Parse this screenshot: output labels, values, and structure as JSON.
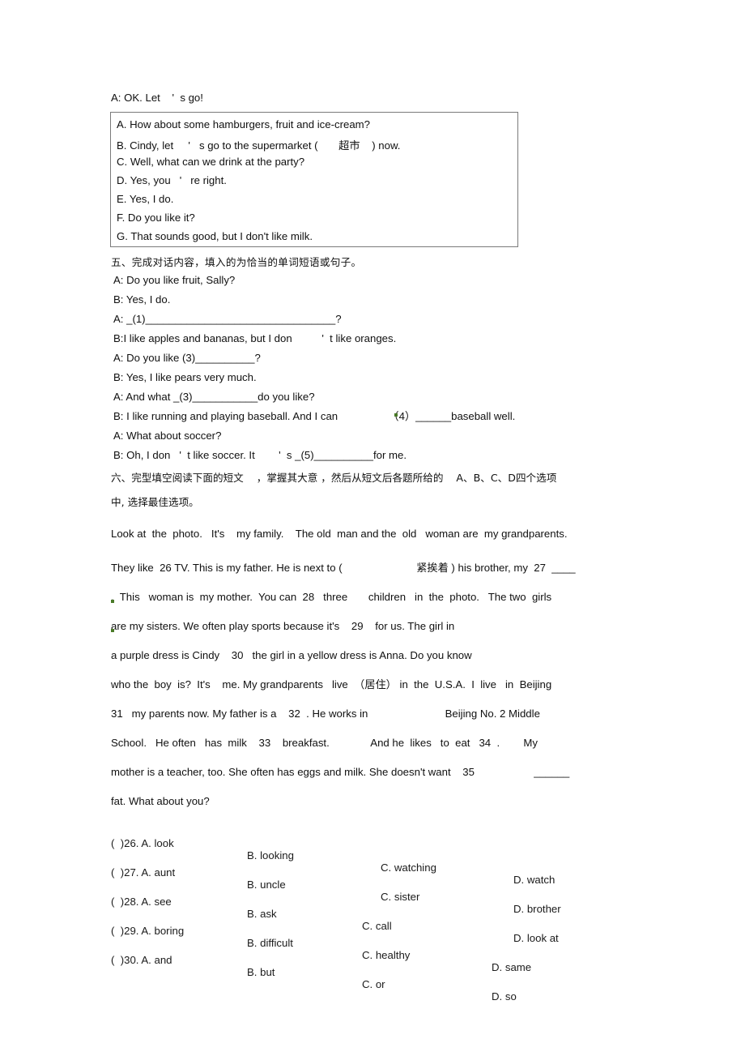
{
  "intro": {
    "line": "A: OK. Let    '  s go!"
  },
  "options_box": {
    "items": [
      "A. How about some hamburgers, fruit and ice-cream?",
      "B. Cindy, let     '   s go to the supermarket (       超市    ) now.",
      "C. Well, what can we drink at the party?",
      "D. Yes, you   '   re right.",
      "E. Yes, I do.",
      "F. Do you like it?",
      "G. That sounds good, but I don't like milk."
    ]
  },
  "section_five": {
    "heading": "五、完成对话内容，填入的为恰当的单词短语或句子。",
    "dialogue": [
      "A: Do you like fruit, Sally?",
      "B: Yes, I do.",
      "A: _(1)________________________________?",
      "B:I like apples and bananas, but I don          '  t like oranges.",
      "A: Do you like (3)__________?",
      "B: Yes, I like pears very much.",
      "A: And what _(3)___________do you like?",
      "B: I like running and playing baseball. And I can                 （4）______baseball well.",
      "A: What about soccer?",
      "B: Oh, I don   '  t like soccer. It        '  s _(5)__________for me."
    ]
  },
  "section_six": {
    "heading_line_1": "六、完型填空阅读下面的短文    ，掌握其大意 ，然后从短文后各题所给的    A、B、C、D四个选项",
    "heading_line_2": "中, 选择最佳选项。",
    "passage": [
      "Look at  the  photo.   It's    my family.    The old  man and the  old   woman are  my grandparents.",
      "They like  26 TV. This is my father. He is next to (                         紧挨着 ) his brother, my  27  ____",
      ".  This   woman is  my mother.  You can  28   three       children   in  the  photo.   The two  girls",
      "are my sisters. We often play sports because it's    29    for us. The girl in ",
      "a purple dress is Cindy    30   the girl in a yellow dress is Anna. Do you know",
      "who the  boy  is?  It's    me. My grandparents   live  （居住） in  the  U.S.A.  I  live   in  Beijing",
      "31   my parents now. My father is a    32  . He works in                          Beijing No. 2 Middle",
      "School.   He often   has  milk    33    breakfast.              And he  likes   to  eat   34  .        My",
      "mother is a teacher, too. She often has eggs and milk. She doesn't want    35                    ______",
      "fat. What about you?"
    ]
  },
  "mcq": {
    "rows": [
      {
        "stem": "(  )26. A. look",
        "b": "B. looking",
        "c": "C. watching",
        "d": "D. watch"
      },
      {
        "stem": "(  )27. A. aunt",
        "b": "B. uncle",
        "c": "C. sister",
        "d": "D. brother"
      },
      {
        "stem": "(  )28. A. see",
        "b": "B. ask",
        "c": "C. call",
        "d": "D. look at"
      },
      {
        "stem": "(  )29. A. boring",
        "b": "B. difficult",
        "c": "C. healthy",
        "d": "D. same"
      },
      {
        "stem": "(  )30. A. and",
        "b": "B. but",
        "c": "C. or",
        "d": "D. so"
      }
    ]
  },
  "colors": {
    "box_border": "#7a7a7a",
    "text": "#101010",
    "blank_rule": "#555555",
    "artifact": "#4a7a28"
  }
}
